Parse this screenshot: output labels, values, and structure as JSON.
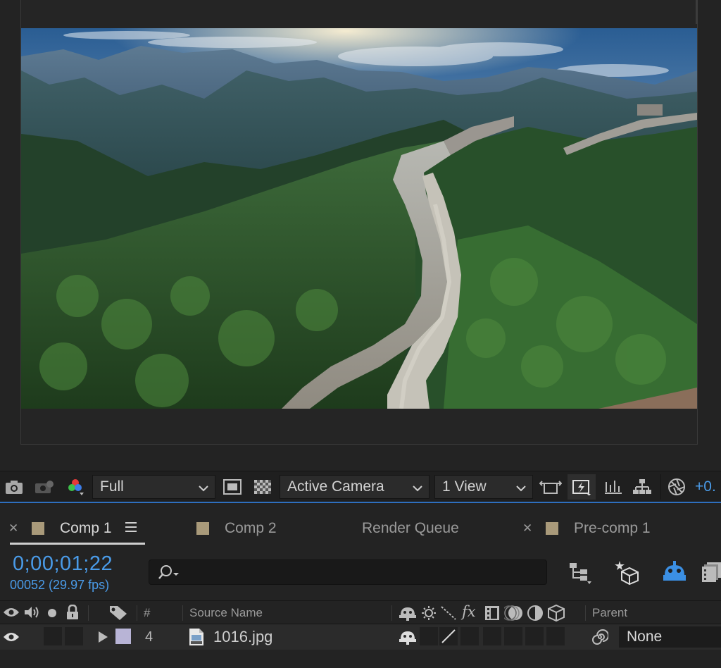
{
  "viewer": {
    "resolution": "Full",
    "camera": "Active Camera",
    "views": "1 View",
    "exposure": "+0."
  },
  "tabs": [
    {
      "label": "Comp 1",
      "active": true,
      "closable": true,
      "swatch": "#a99a7a"
    },
    {
      "label": "Comp 2",
      "active": false,
      "closable": false,
      "swatch": "#a99a7a"
    },
    {
      "label": "Render Queue",
      "active": false,
      "closable": false
    },
    {
      "label": "Pre-comp 1",
      "active": false,
      "closable": true,
      "swatch": "#a99a7a"
    }
  ],
  "timeline": {
    "timecode": "0;00;01;22",
    "frames": "00052 (29.97 fps)",
    "search_placeholder": ""
  },
  "columns": {
    "number": "#",
    "source_name": "Source Name",
    "parent": "Parent"
  },
  "layer": {
    "number": "4",
    "name": "1016.jpg",
    "label_color": "#b8b4d6",
    "parent": "None"
  },
  "colors": {
    "accent": "#4a9be8",
    "panel": "#232323",
    "toolbar": "#1f1f1f"
  }
}
